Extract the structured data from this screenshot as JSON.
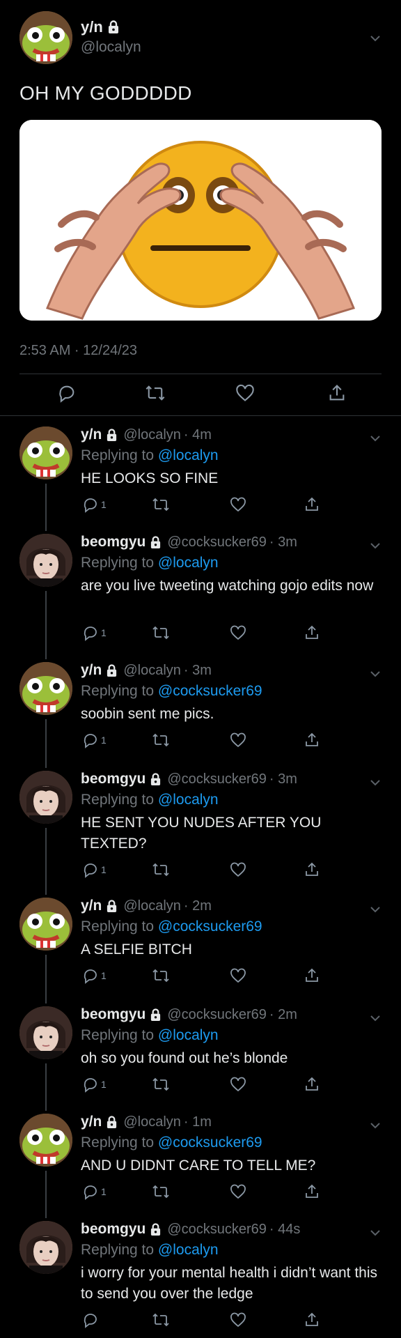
{
  "main_tweet": {
    "display_name": "y/n",
    "handle": "@localyn",
    "text": "OH MY GODDDDD",
    "timestamp": "2:53 AM · 12/24/23",
    "media_icon": "cursed-emoji-hands-image"
  },
  "replies": [
    {
      "display_name": "y/n",
      "handle": "@localyn",
      "time": "· 4m",
      "replying_prefix": "Replying to ",
      "replying_to": "@localyn",
      "text": "HE LOOKS SO FINE",
      "reply_count": "1",
      "avatar": "frog-avatar"
    },
    {
      "display_name": "beomgyu",
      "handle": "@cocksucker69",
      "time": "· 3m",
      "replying_prefix": "Replying to ",
      "replying_to": "@localyn",
      "text": "are you live tweeting watching gojo edits now",
      "reply_count": "1",
      "avatar": "person-avatar"
    },
    {
      "display_name": "y/n",
      "handle": "@localyn",
      "time": "· 3m",
      "replying_prefix": "Replying to ",
      "replying_to": "@cocksucker69",
      "text": "soobin sent me pics.",
      "reply_count": "1",
      "avatar": "frog-avatar"
    },
    {
      "display_name": "beomgyu",
      "handle": "@cocksucker69",
      "time": "· 3m",
      "replying_prefix": "Replying to ",
      "replying_to": "@localyn",
      "text": "HE SENT YOU NUDES AFTER YOU TEXTED?",
      "reply_count": "1",
      "avatar": "person-avatar"
    },
    {
      "display_name": "y/n",
      "handle": "@localyn",
      "time": "· 2m",
      "replying_prefix": "Replying to ",
      "replying_to": "@cocksucker69",
      "text": "A SELFIE BITCH",
      "reply_count": "1",
      "avatar": "frog-avatar"
    },
    {
      "display_name": "beomgyu",
      "handle": "@cocksucker69",
      "time": "· 2m",
      "replying_prefix": "Replying to ",
      "replying_to": "@localyn",
      "text": "oh so you found out he’s blonde",
      "reply_count": "1",
      "avatar": "person-avatar"
    },
    {
      "display_name": "y/n",
      "handle": "@localyn",
      "time": "· 1m",
      "replying_prefix": "Replying to ",
      "replying_to": "@cocksucker69",
      "text": "AND U DIDNT CARE TO TELL ME?",
      "reply_count": "1",
      "avatar": "frog-avatar"
    },
    {
      "display_name": "beomgyu",
      "handle": "@cocksucker69",
      "time": "· 44s",
      "replying_prefix": "Replying to ",
      "replying_to": "@localyn",
      "text": "i worry for your mental health i didn’t want this to send you over the ledge",
      "reply_count": "",
      "avatar": "person-avatar"
    }
  ],
  "icons": {
    "reply": "reply-icon",
    "retweet": "retweet-icon",
    "like": "heart-icon",
    "share": "share-icon",
    "lock": "lock-icon",
    "more": "chevron-down-icon"
  },
  "colors": {
    "background": "#000000",
    "text": "#e7e9ea",
    "muted": "#71767b",
    "link": "#1d9bf0"
  }
}
